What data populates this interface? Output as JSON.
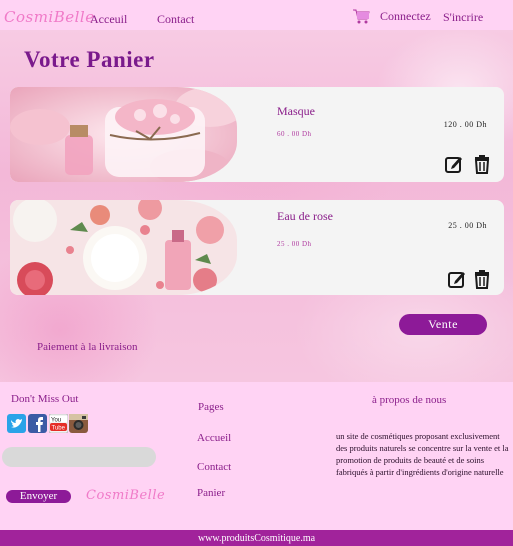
{
  "brand": {
    "logo": "CosmiBelle"
  },
  "nav": {
    "accueil": "Acceuil",
    "contact": "Contact",
    "connect": "Connectez",
    "signup": "S'incrire"
  },
  "page": {
    "title": "Votre Panier"
  },
  "cart": {
    "items": [
      {
        "name": "Masque",
        "unit_price": "60 . 00 Dh",
        "total": "120 . 00 Dh"
      },
      {
        "name": "Eau de rose",
        "unit_price": "25 . 00 Dh",
        "total": "25 . 00 Dh"
      }
    ],
    "sell_label": "Vente",
    "cod_label": "Paiement à la livraison"
  },
  "footer": {
    "dont_miss": "Don't Miss Out",
    "newsletter_placeholder": "",
    "send_label": "Envoyer",
    "pages_head": "Pages",
    "links": {
      "accueil": "Accueil",
      "contact": "Contact",
      "panier": "Panier"
    },
    "about_head": "à propos de nous",
    "about_text": "un site de cosmétiques proposant exclusivement des produits naturels se concentre sur la vente et la promotion de produits de beauté et de soins fabriqués à partir d'ingrédients d'origine naturelle",
    "site_url": "www.produitsCosmitique.ma"
  },
  "colors": {
    "accent": "#8d1a98",
    "header_bg": "#ffd3f4",
    "logo": "#f07ac8",
    "card_bg": "#f4f4f4"
  },
  "icons": [
    "cart-icon",
    "edit-icon",
    "trash-icon",
    "twitter-icon",
    "facebook-icon",
    "youtube-icon",
    "instagram-icon"
  ]
}
